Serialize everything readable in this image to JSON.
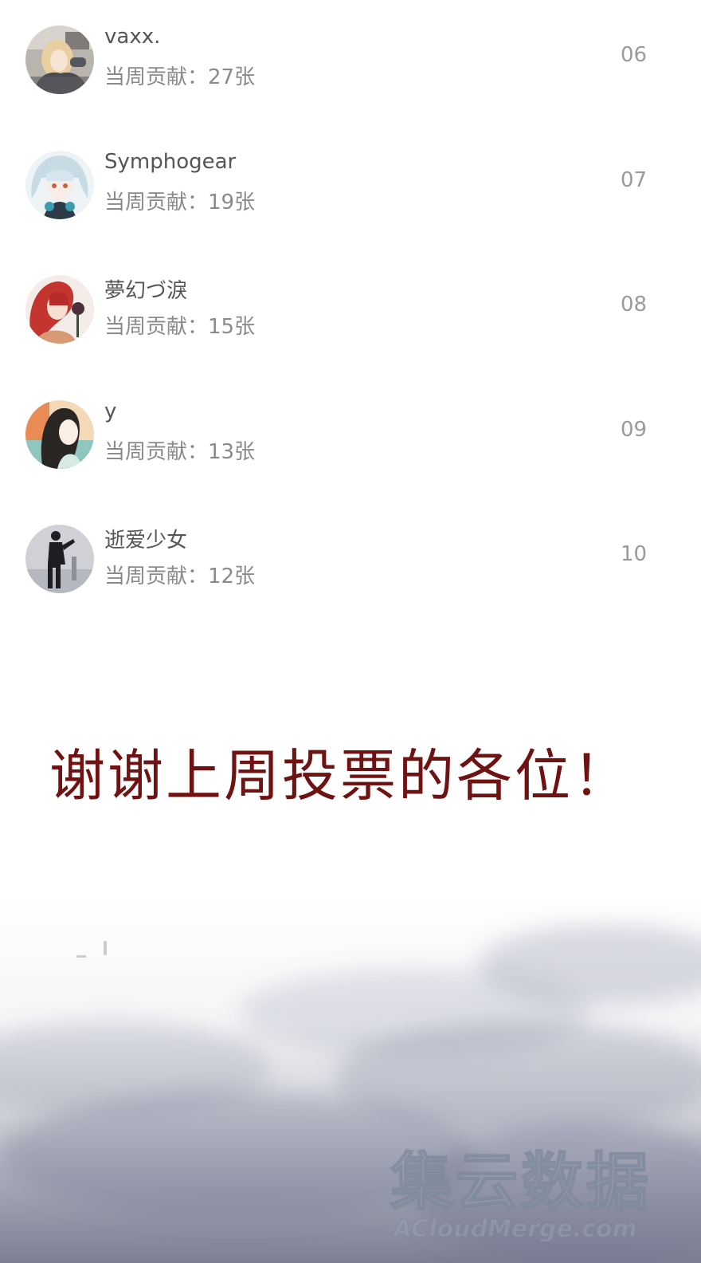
{
  "ranking": {
    "items": [
      {
        "name": "vaxx.",
        "contribution": "当周贡献：27张",
        "rank": "06",
        "avatar_icon": "avatar-girl-blonde-icon"
      },
      {
        "name": "Symphogear",
        "contribution": "当周贡献：19张",
        "rank": "07",
        "avatar_icon": "avatar-girl-silver-hair-icon"
      },
      {
        "name": "夢幻づ淚",
        "contribution": "当周贡献：15张",
        "rank": "08",
        "avatar_icon": "avatar-girl-red-hair-rose-icon"
      },
      {
        "name": "y",
        "contribution": "当周贡献：13张",
        "rank": "09",
        "avatar_icon": "avatar-girl-black-hair-icon"
      },
      {
        "name": "逝爱少女",
        "contribution": "当周贡献：12张",
        "rank": "10",
        "avatar_icon": "avatar-silhouette-figure-icon"
      }
    ]
  },
  "thanks": {
    "text": "谢谢上周投票的各位！"
  },
  "watermark": {
    "cn": "集云数据",
    "en": "ACloudMerge.com"
  },
  "colors": {
    "name_text": "#555555",
    "contribution_text": "#8a8a8a",
    "rank_text": "#9a9a9a",
    "thanks_text": "#6e1212",
    "fog": "#5a5f78"
  }
}
